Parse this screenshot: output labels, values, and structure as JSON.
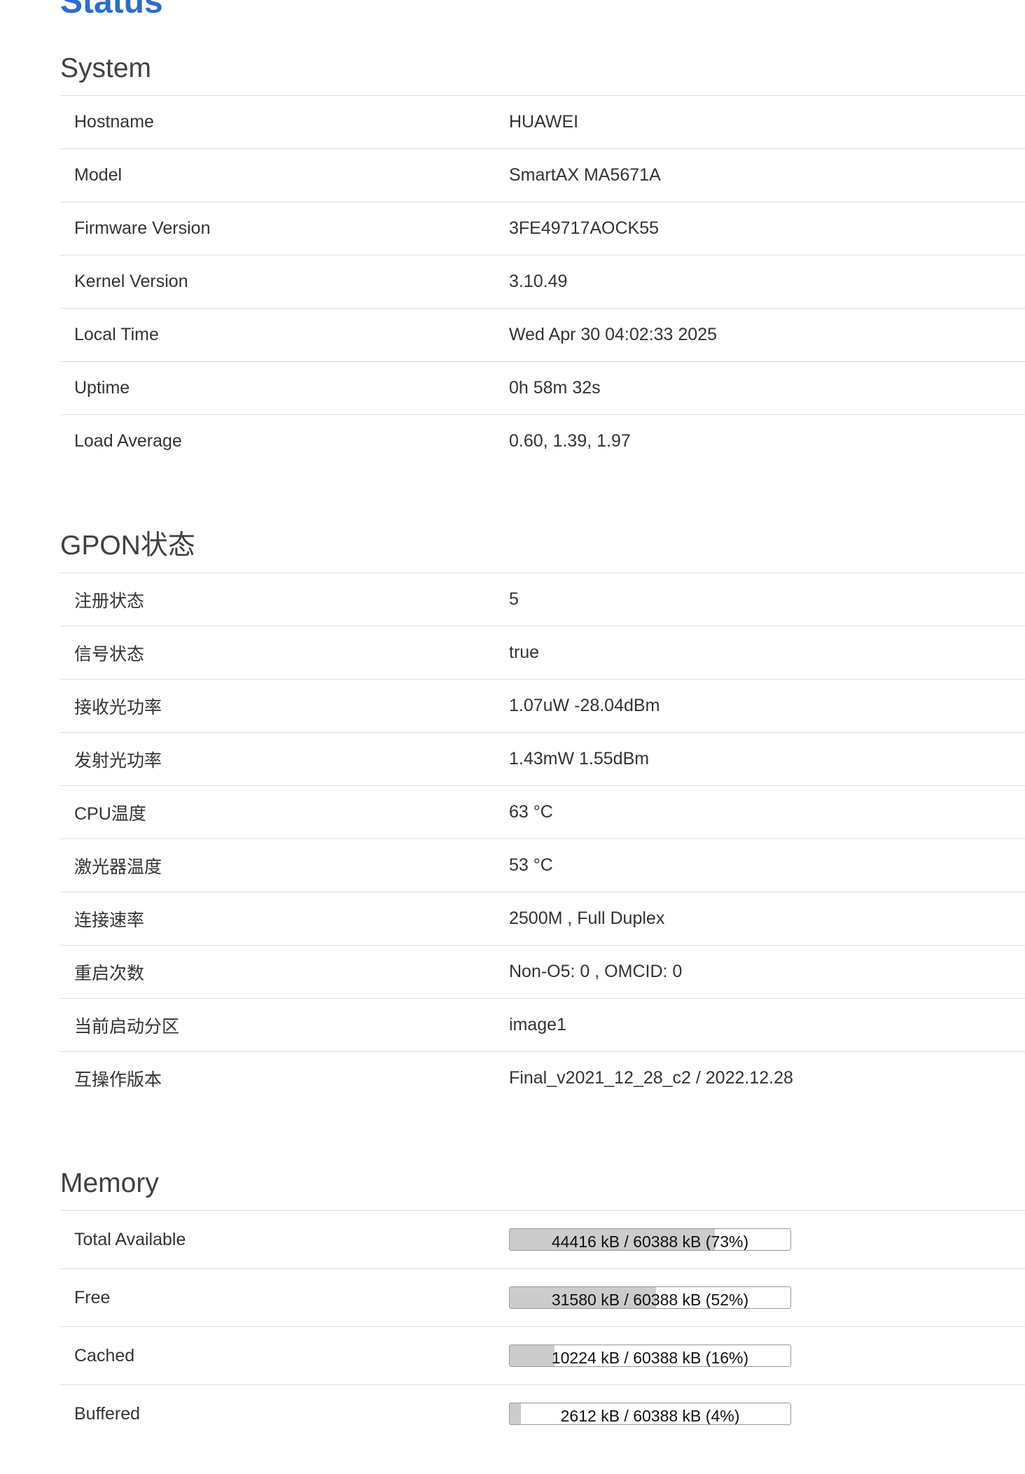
{
  "page_title": "Status",
  "system": {
    "title": "System",
    "rows": [
      {
        "label": "Hostname",
        "value": "HUAWEI"
      },
      {
        "label": "Model",
        "value": "SmartAX MA5671A"
      },
      {
        "label": "Firmware Version",
        "value": "3FE49717AOCK55"
      },
      {
        "label": "Kernel Version",
        "value": "3.10.49"
      },
      {
        "label": "Local Time",
        "value": "Wed Apr 30 04:02:33 2025"
      },
      {
        "label": "Uptime",
        "value": "0h 58m 32s"
      },
      {
        "label": "Load Average",
        "value": "0.60, 1.39, 1.97"
      }
    ]
  },
  "gpon": {
    "title": "GPON状态",
    "rows": [
      {
        "label": "注册状态",
        "value": "5"
      },
      {
        "label": "信号状态",
        "value": "true"
      },
      {
        "label": "接收光功率",
        "value": "1.07uW -28.04dBm"
      },
      {
        "label": "发射光功率",
        "value": "1.43mW 1.55dBm"
      },
      {
        "label": "CPU温度",
        "value": "63 °C"
      },
      {
        "label": "激光器温度",
        "value": "53 °C"
      },
      {
        "label": "连接速率",
        "value": "2500M , Full Duplex"
      },
      {
        "label": "重启次数",
        "value": "Non-O5: 0 , OMCID: 0"
      },
      {
        "label": "当前启动分区",
        "value": "image1"
      },
      {
        "label": "互操作版本",
        "value": "Final_v2021_12_28_c2 / 2022.12.28"
      }
    ]
  },
  "memory": {
    "title": "Memory",
    "rows": [
      {
        "label": "Total Available",
        "value": "44416 kB / 60388 kB (73%)",
        "percent": 73
      },
      {
        "label": "Free",
        "value": "31580 kB / 60388 kB (52%)",
        "percent": 52
      },
      {
        "label": "Cached",
        "value": "10224 kB / 60388 kB (16%)",
        "percent": 16
      },
      {
        "label": "Buffered",
        "value": "2612 kB / 60388 kB (4%)",
        "percent": 4
      }
    ]
  },
  "colors": {
    "title": "#2b6bd3",
    "heading": "#404040",
    "text": "#333333",
    "divider": "#dddddd",
    "bar_fill": "#cccccc",
    "bar_border": "#999999"
  }
}
